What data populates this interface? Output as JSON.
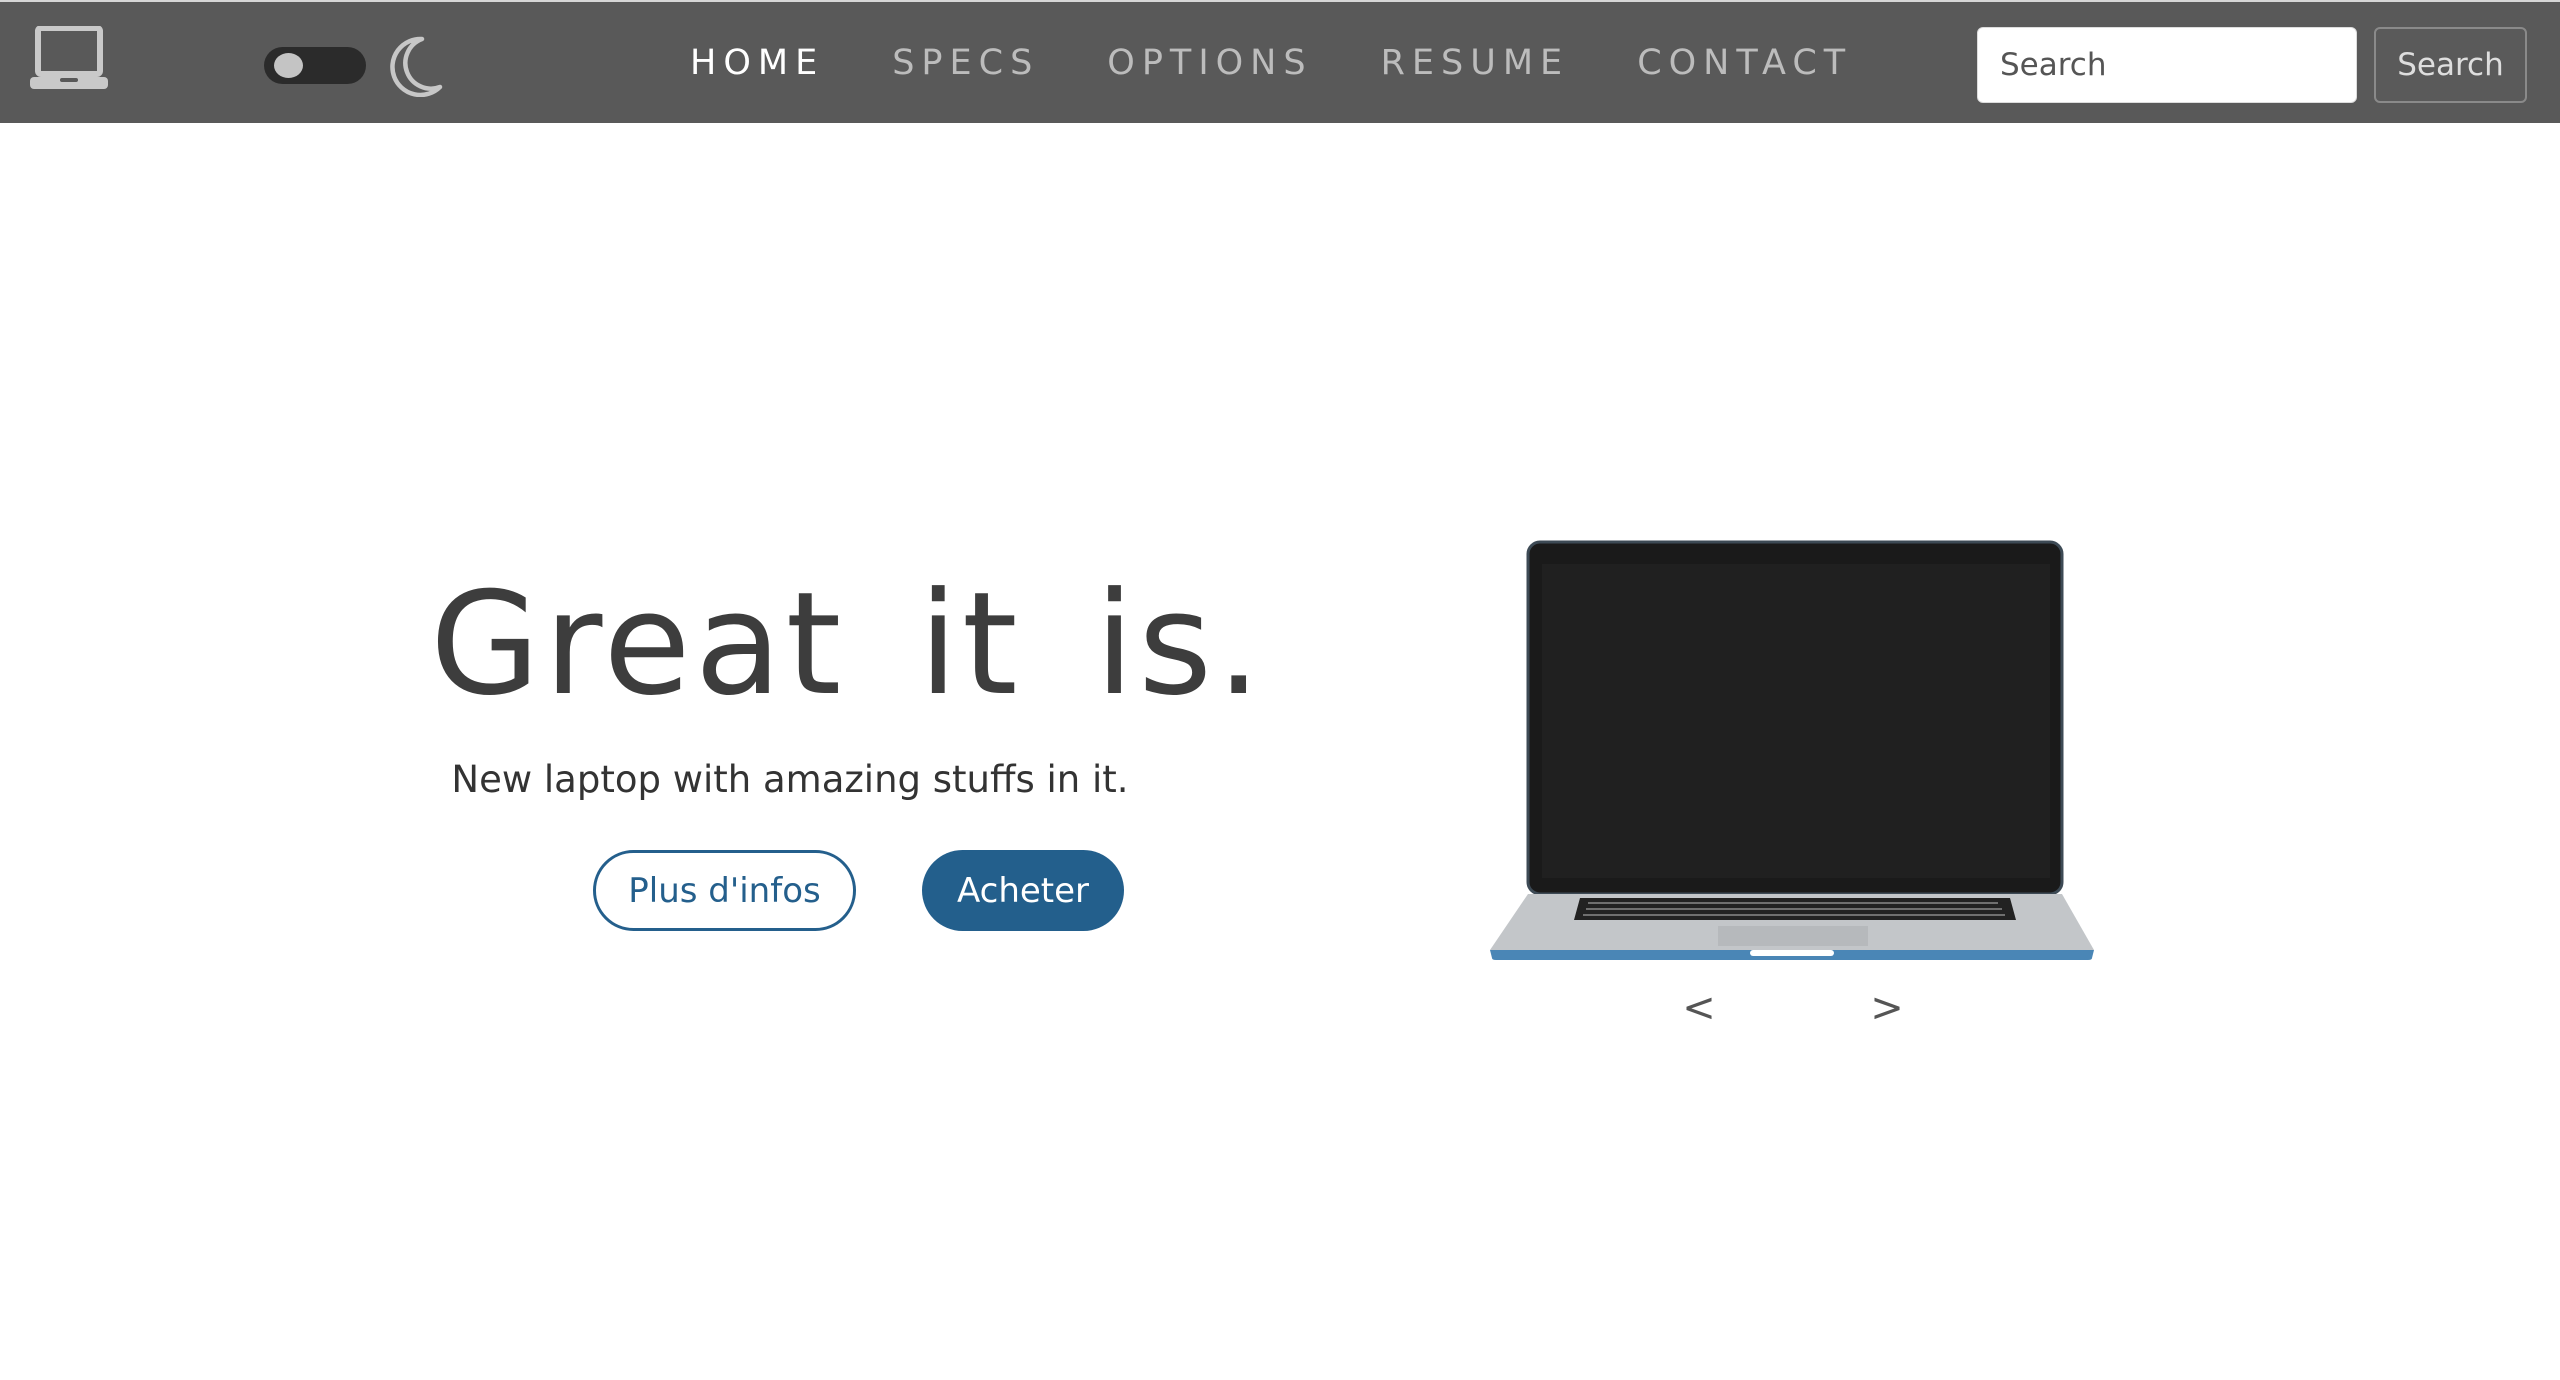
{
  "colors": {
    "navbar_bg": "#595959",
    "nav_link": "#bcbcbc",
    "nav_link_active": "#ffffff",
    "accent": "#245f8c",
    "title": "#3d3d3d"
  },
  "navbar": {
    "logo_icon": "laptop-icon",
    "theme_toggle": {
      "state": "off",
      "icon": "moon-icon"
    },
    "links": [
      {
        "label": "HOME",
        "active": true
      },
      {
        "label": "SPECS",
        "active": false
      },
      {
        "label": "OPTIONS",
        "active": false
      },
      {
        "label": "RESUME",
        "active": false
      },
      {
        "label": "CONTACT",
        "active": false
      }
    ],
    "search": {
      "placeholder": "Search",
      "value": "",
      "button_label": "Search"
    }
  },
  "hero": {
    "title": "Great it is.",
    "subtitle": "New laptop with amazing stuffs in it.",
    "more_info_label": "Plus d'infos",
    "buy_label": "Acheter"
  },
  "carousel": {
    "prev_label": "<",
    "next_label": ">",
    "image": "laptop-image"
  }
}
